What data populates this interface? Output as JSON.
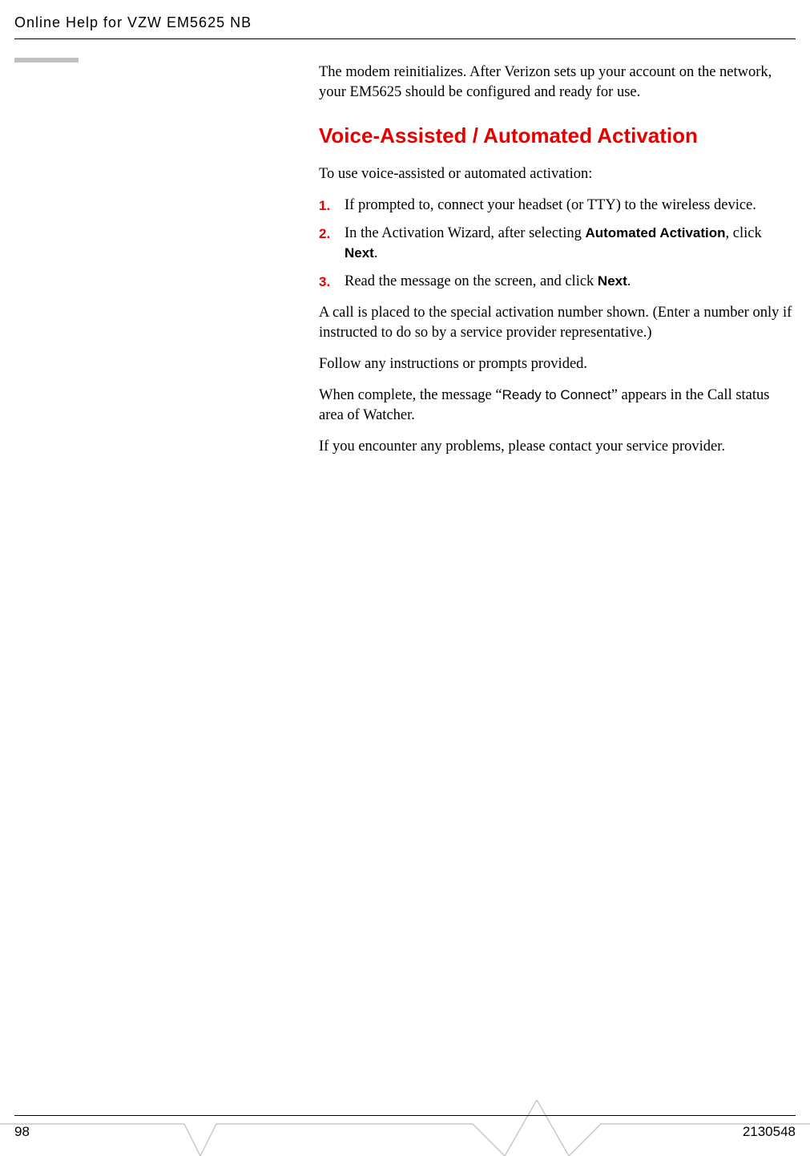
{
  "header": {
    "title": "Online Help for VZW EM5625 NB"
  },
  "content": {
    "intro_para": "The modem reinitializes. After Verizon sets up your account on the network, your EM5625 should be configured and ready for use.",
    "heading": "Voice-Assisted / Automated Activation",
    "lead_in": "To use voice-assisted or automated activation:",
    "steps": [
      {
        "num": "1.",
        "text_a": "If prompted to, connect your headset (or TTY) to the wireless device."
      },
      {
        "num": "2.",
        "text_a": "In the Activation Wizard, after selecting ",
        "bold_a": "Automated Activation",
        "text_b": ", click ",
        "bold_b": "Next",
        "text_c": "."
      },
      {
        "num": "3.",
        "text_a": "Read the message on the screen, and click ",
        "bold_a": "Next",
        "text_b": "."
      }
    ],
    "para_2": "A call is placed to the special activation number shown. (Enter a number only if instructed to do so by a service provider representative.)",
    "para_3": "Follow any instructions or prompts provided.",
    "para_4_a": "When complete, the message “",
    "para_4_sans": "Ready to Connect",
    "para_4_b": "” appears in the Call status area of Watcher.",
    "para_5": "If you encounter any problems, please contact your service provider."
  },
  "footer": {
    "page": "98",
    "docid": "2130548"
  }
}
